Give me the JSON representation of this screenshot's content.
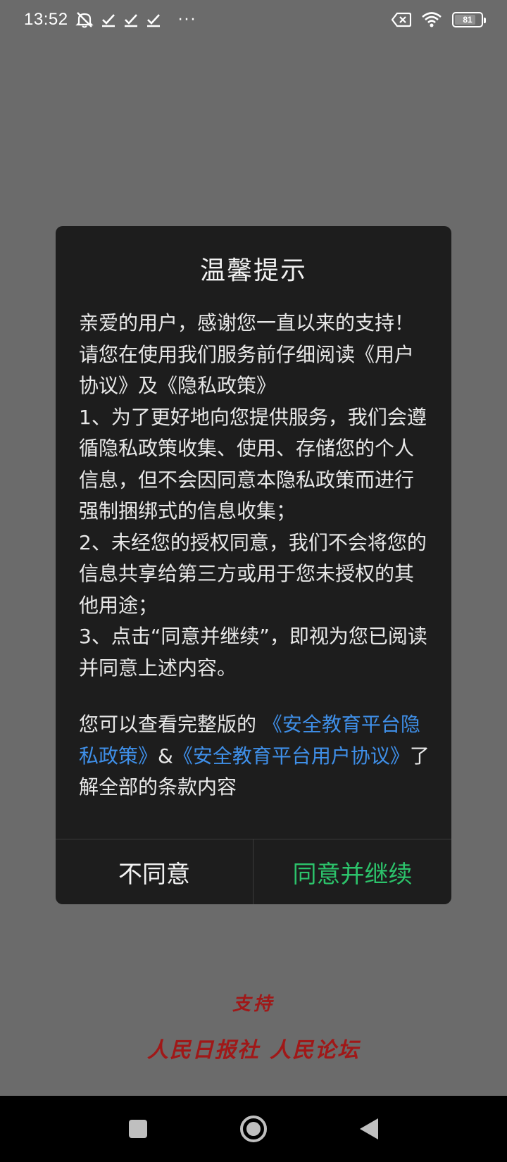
{
  "status_bar": {
    "time": "13:52",
    "battery_level": "81",
    "more_glyph": "···",
    "icons": [
      "notifications-muted-icon",
      "check-icon",
      "check-icon",
      "check-icon",
      "more-dots-icon",
      "no-sim-icon",
      "wifi-icon",
      "battery-icon"
    ]
  },
  "dialog": {
    "title": "温馨提示",
    "paragraphs": [
      "亲爱的用户，感谢您一直以来的支持！请您在使用我们服务前仔细阅读《用户协议》及《隐私政策》",
      " 1、为了更好地向您提供服务，我们会遵循隐私政策收集、使用、存储您的个人信息，但不会因同意本隐私政策而进行强制捆绑式的信息收集；",
      " 2、未经您的授权同意，我们不会将您的信息共享给第三方或用于您未授权的其他用途；",
      " 3、点击“同意并继续”，即视为您已阅读并同意上述内容。"
    ],
    "footer": {
      "prefix": "您可以查看完整版的 ",
      "privacy_link": "《安全教育平台隐私政策》",
      "separator": "&",
      "agreement_link": "《安全教育平台用户协议》",
      "suffix": "了解全部的条款内容"
    },
    "decline_label": "不同意",
    "accept_label": "同意并继续"
  },
  "sponsor": {
    "support": "支持",
    "org_1": "人民日报社",
    "org_2": "人民论坛"
  },
  "colors": {
    "backdrop": "#6b6b6b",
    "dialog_bg": "#1d1d1d",
    "link": "#3f8fe8",
    "accept": "#2cc36b",
    "sponsor": "#a01818"
  }
}
